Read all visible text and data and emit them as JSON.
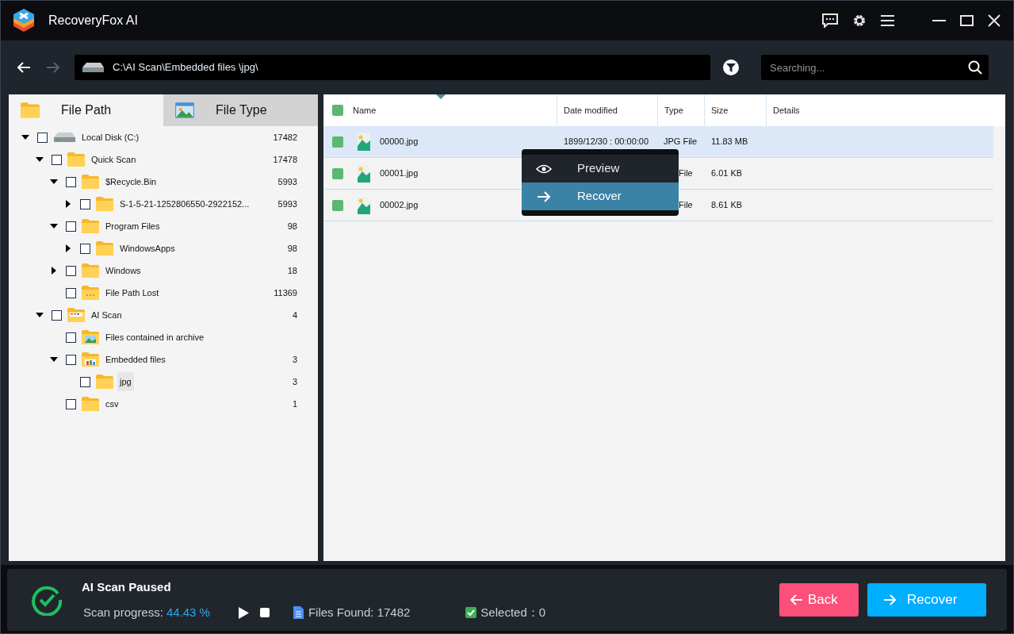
{
  "window": {
    "title": "RecoveryFox AI"
  },
  "path_bar": {
    "path": "C:\\AI Scan\\Embedded files \\jpg\\"
  },
  "search": {
    "placeholder": "Searching..."
  },
  "tabs": [
    {
      "label": "File Path",
      "selected": true,
      "kind": "folder"
    },
    {
      "label": "File Type",
      "selected": false,
      "kind": "picture"
    }
  ],
  "tree": [
    {
      "label": "Local Disk (C:)",
      "count": "17482",
      "kind": "disk",
      "expanded": true,
      "selected": false,
      "checked": false,
      "children": [
        {
          "label": "Quick Scan",
          "count": "17478",
          "kind": "folder",
          "expanded": true,
          "selected": false,
          "checked": false,
          "children": [
            {
              "label": "$Recycle.Bin",
              "count": "5993",
              "kind": "folder",
              "expanded": true,
              "selected": false,
              "checked": false,
              "children": [
                {
                  "label": "S-1-5-21-1252806550-2922152...",
                  "count": "5993",
                  "kind": "folder",
                  "expanded": false,
                  "selected": false,
                  "checked": false
                }
              ]
            },
            {
              "label": "Program Files",
              "count": "98",
              "kind": "folder",
              "expanded": true,
              "selected": false,
              "checked": false,
              "children": [
                {
                  "label": "WindowsApps",
                  "count": "98",
                  "kind": "folder",
                  "expanded": false,
                  "selected": false,
                  "checked": false
                }
              ]
            },
            {
              "label": "Windows",
              "count": "18",
              "kind": "folder",
              "expanded": false,
              "selected": false,
              "checked": false
            },
            {
              "label": "File Path Lost",
              "count": "11369",
              "kind": "lost",
              "selected": false,
              "checked": false
            }
          ]
        },
        {
          "label": "AI Scan",
          "count": "4",
          "kind": "ai",
          "expanded": true,
          "selected": false,
          "checked": false,
          "children": [
            {
              "label": "Files contained in archive",
              "kind": "archive",
              "selected": false,
              "checked": false
            },
            {
              "label": "Embedded files",
              "count": "3",
              "kind": "embedded",
              "expanded": true,
              "selected": false,
              "checked": false,
              "children": [
                {
                  "label": "jpg",
                  "count": "3",
                  "kind": "folder",
                  "selected": true,
                  "checked": false
                }
              ]
            },
            {
              "label": "csv",
              "count": "1",
              "kind": "folder",
              "selected": false,
              "checked": false
            }
          ]
        }
      ]
    }
  ],
  "table": {
    "all_checked": true,
    "columns": [
      "Name",
      "Date modified",
      "Type",
      "Size",
      "Details"
    ],
    "rows": [
      {
        "name": "00000.jpg",
        "date": "1899/12/30 : 00:00:00",
        "type": "JPG File",
        "size": "11.83 MB",
        "selected": true,
        "checked": true
      },
      {
        "name": "00001.jpg",
        "type": "File",
        "size": "6.01 KB",
        "selected": false,
        "checked": true
      },
      {
        "name": "00002.jpg",
        "type": "File",
        "size": "8.61 KB",
        "selected": false,
        "checked": true
      }
    ]
  },
  "context_menu": [
    {
      "label": "Preview",
      "kind": "eye",
      "selected": false
    },
    {
      "label": "Recover",
      "kind": "arrow",
      "selected": true
    }
  ],
  "status": {
    "title": "AI Scan Paused",
    "progress_label": "Scan progress:",
    "progress_value": "44.43 %",
    "files_found": "Files Found: 17482",
    "selected": "Selected：0"
  },
  "buttons": [
    {
      "label": "Back",
      "kind": "back"
    },
    {
      "label": "Recover",
      "kind": "recover"
    }
  ]
}
